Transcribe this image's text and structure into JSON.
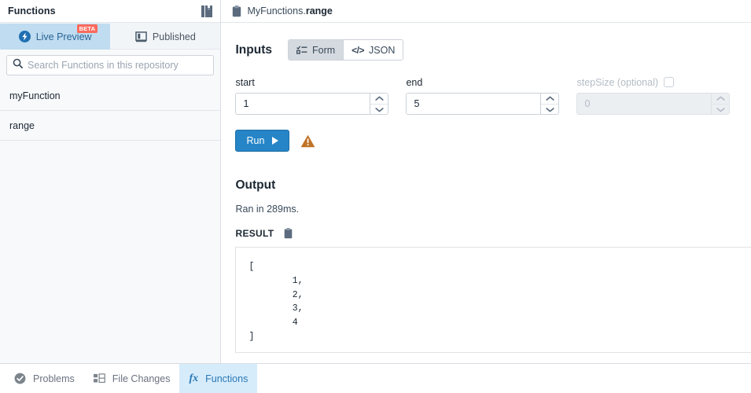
{
  "sidebar": {
    "title": "Functions",
    "book_icon": "book-icon",
    "tabs": [
      {
        "label": "Live Preview",
        "icon": "lightning-bolt-icon",
        "badge": "BETA",
        "active": true
      },
      {
        "label": "Published",
        "icon": "monitor-icon",
        "active": false
      }
    ],
    "search": {
      "placeholder": "Search Functions in this repository",
      "value": "",
      "icon": "search-icon"
    },
    "functions": [
      {
        "label": "myFunction"
      },
      {
        "label": "range"
      }
    ]
  },
  "main": {
    "breadcrumb_icon": "clipboard-icon",
    "breadcrumb_prefix": "MyFunctions.",
    "breadcrumb_name": "range",
    "inputs": {
      "title": "Inputs",
      "modes": [
        {
          "label": "Form",
          "icon": "form-list-icon",
          "active": true
        },
        {
          "label": "JSON",
          "icon": "code-brackets-icon",
          "active": false
        }
      ],
      "fields": [
        {
          "name": "start",
          "label": "start",
          "value": "1",
          "placeholder": "",
          "disabled": false,
          "optional": false
        },
        {
          "name": "end",
          "label": "end",
          "value": "5",
          "placeholder": "",
          "disabled": false,
          "optional": false
        },
        {
          "name": "stepSize",
          "label": "stepSize (optional)",
          "value": "",
          "placeholder": "0",
          "disabled": true,
          "optional": true
        }
      ]
    },
    "run": {
      "label": "Run",
      "play_icon": "play-triangle-icon",
      "warning_icon": "warning-triangle-icon"
    },
    "output": {
      "title": "Output",
      "ran_text": "Ran in 289ms.",
      "result_label": "RESULT",
      "result_copy_icon": "clipboard-icon",
      "result_json": "[\n        1,\n        2,\n        3,\n        4\n]"
    }
  },
  "statusbar": {
    "items": [
      {
        "label": "Problems",
        "icon": "check-circle-icon",
        "active": false
      },
      {
        "label": "File Changes",
        "icon": "file-changes-icon",
        "active": false
      },
      {
        "label": "Functions",
        "icon": "fx-icon",
        "active": true
      }
    ]
  },
  "colors": {
    "accent_blue": "#2585c7",
    "tab_active_bg": "#bfdcf0",
    "badge_red": "#fb6a5b",
    "warning_orange": "#bf7326",
    "status_active_bg": "#d6ecfb"
  }
}
